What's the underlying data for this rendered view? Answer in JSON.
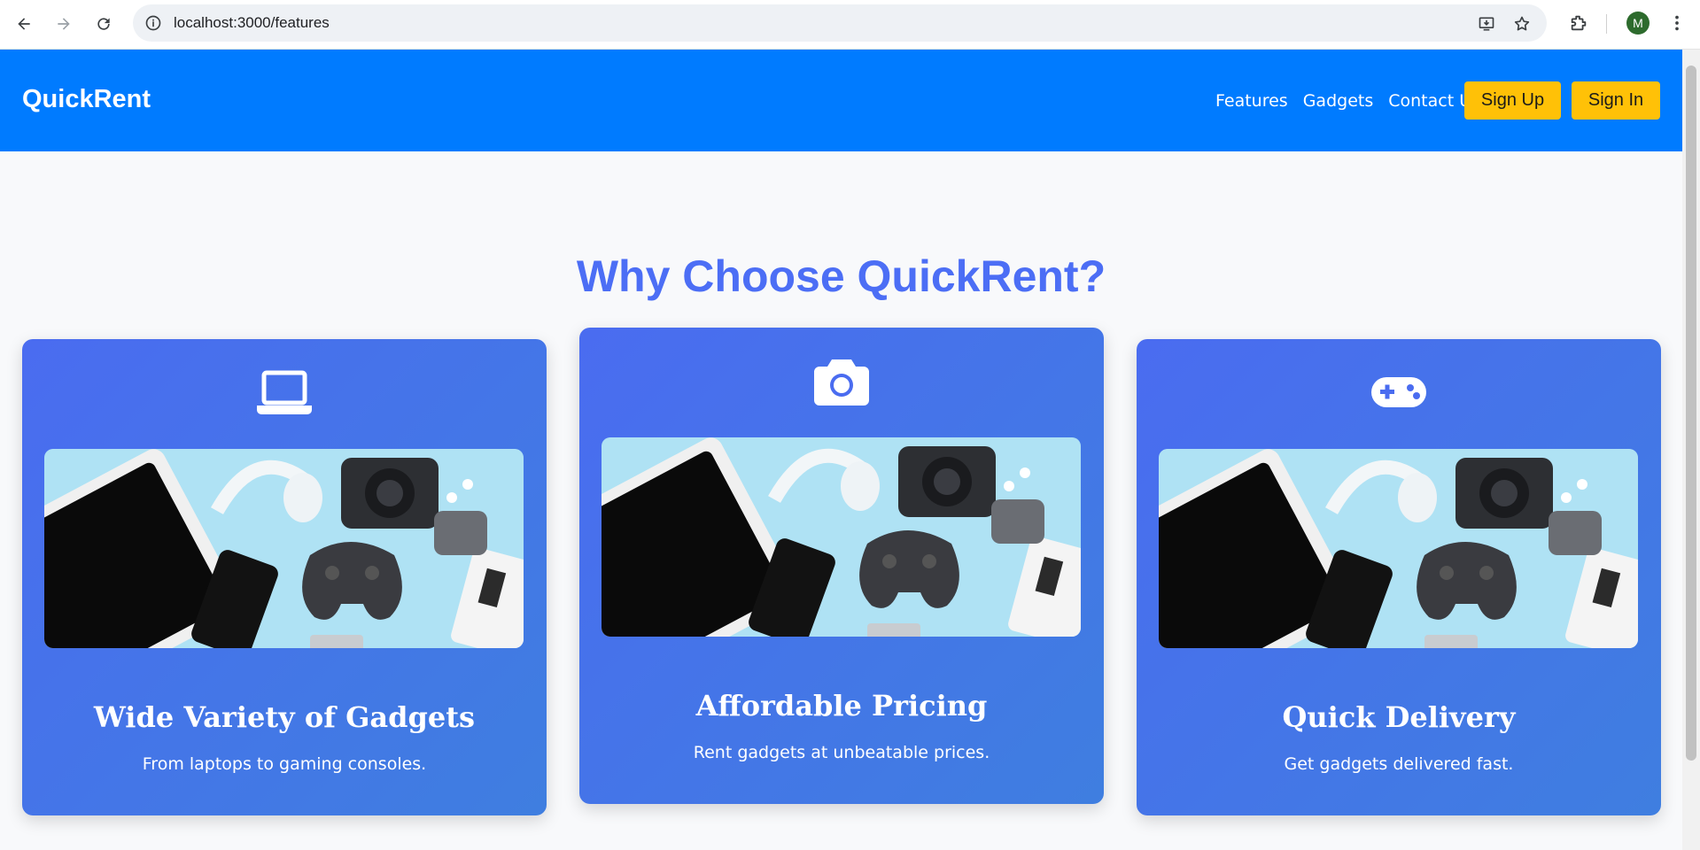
{
  "browser": {
    "url": "localhost:3000/features",
    "profile_initial": "M"
  },
  "header": {
    "brand": "QuickRent",
    "nav": [
      "Features",
      "Gadgets",
      "Contact Us"
    ],
    "signup_label": "Sign Up",
    "signin_label": "Sign In",
    "color": "#007bff",
    "button_color": "#ffc107"
  },
  "main": {
    "heading": "Why Choose QuickRent?",
    "cards": [
      {
        "icon": "laptop-icon",
        "title": "Wide Variety of Gadgets",
        "desc": "From laptops to gaming consoles."
      },
      {
        "icon": "camera-icon",
        "title": "Affordable Pricing",
        "desc": "Rent gadgets at unbeatable prices."
      },
      {
        "icon": "gamepad-icon",
        "title": "Quick Delivery",
        "desc": "Get gadgets delivered fast."
      }
    ]
  },
  "colors": {
    "heading": "#4c6ef5",
    "card_gradient_start": "#4a6cf0",
    "card_gradient_end": "#3f7ee0"
  }
}
